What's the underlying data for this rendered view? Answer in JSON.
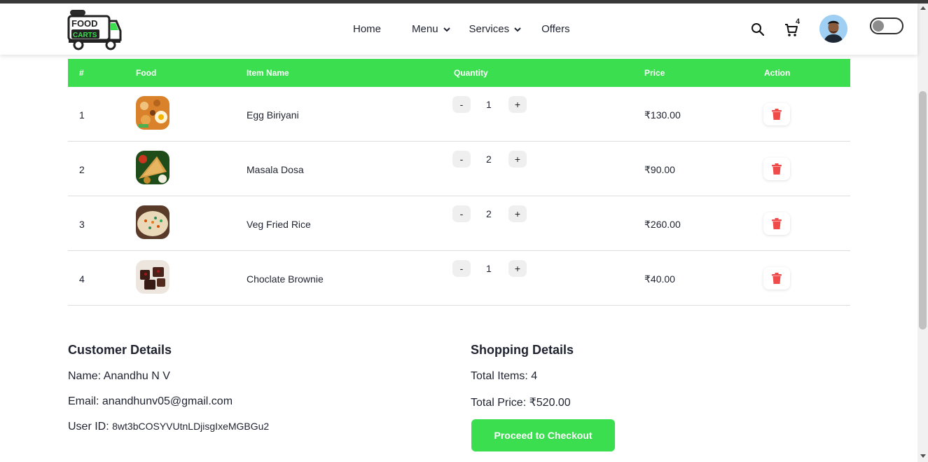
{
  "brand": {
    "logo_line1": "FOOD",
    "logo_line2": "CARTS"
  },
  "nav": {
    "links": [
      {
        "label": "Home"
      },
      {
        "label": "Menu"
      },
      {
        "label": "Services"
      },
      {
        "label": "Offers"
      }
    ],
    "cart_count": "4"
  },
  "colors": {
    "accent": "#3ade4e",
    "delete": "#f04b4b"
  },
  "table": {
    "headers": [
      "#",
      "Food",
      "Item Name",
      "Quantity",
      "Price",
      "Action"
    ],
    "rows": [
      {
        "index": "1",
        "name": "Egg Biriyani",
        "qty": "1",
        "price": "₹130.00",
        "minus": "-",
        "plus": "+"
      },
      {
        "index": "2",
        "name": "Masala Dosa",
        "qty": "2",
        "price": "₹90.00",
        "minus": "-",
        "plus": "+"
      },
      {
        "index": "3",
        "name": "Veg Fried Rice",
        "qty": "2",
        "price": "₹260.00",
        "minus": "-",
        "plus": "+"
      },
      {
        "index": "4",
        "name": "Choclate Brownie",
        "qty": "1",
        "price": "₹40.00",
        "minus": "-",
        "plus": "+"
      }
    ]
  },
  "customer": {
    "title": "Customer Details",
    "name_label": "Name: Anandhu N V",
    "email_label": "Email: anandhunv05@gmail.com",
    "uid_label": "User ID:",
    "uid_value": "8wt3bCOSYVUtnLDjisgIxeMGBGu2"
  },
  "shopping": {
    "title": "Shopping Details",
    "total_items": "Total Items: 4",
    "total_price": "Total Price: ₹520.00",
    "checkout_label": "Proceed to Checkout"
  }
}
